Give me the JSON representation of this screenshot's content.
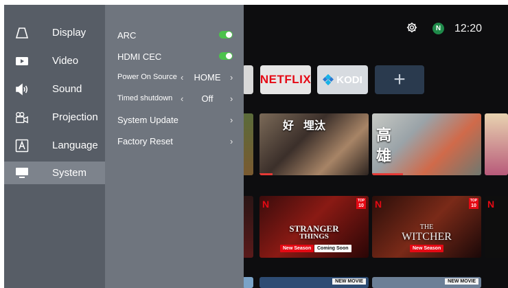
{
  "status_bar": {
    "settings_icon": "gear-icon",
    "profile_initial": "N",
    "time": "12:20"
  },
  "apps": [
    {
      "name": "NETFLIX",
      "icon": "netflix-logo"
    },
    {
      "name": "KODI",
      "icon": "kodi-logo"
    },
    {
      "name": "+",
      "icon": "add-icon"
    }
  ],
  "rows": {
    "row1": [
      {
        "title_a": "好",
        "title_b": "埋汰"
      },
      {
        "title_a": "高",
        "title_b": "雄"
      }
    ],
    "row2": [
      {
        "brand": "N",
        "badge_top": "TOP",
        "badge_num": "10",
        "logo_line1": "STRANGER",
        "logo_line2": "THINGS",
        "tag1": "New Season",
        "tag2": "Coming Soon"
      },
      {
        "brand": "N",
        "badge_top": "TOP",
        "badge_num": "10",
        "logo_line1": "THE",
        "logo_line2": "WITCHER",
        "tag1": "New Season"
      }
    ],
    "row2_partial_brand": "N",
    "row3_badge": "NEW MOVIE"
  },
  "settings": {
    "categories": [
      {
        "label": "Display",
        "icon": "display-icon"
      },
      {
        "label": "Video",
        "icon": "video-icon"
      },
      {
        "label": "Sound",
        "icon": "sound-icon"
      },
      {
        "label": "Projection",
        "icon": "projection-icon"
      },
      {
        "label": "Language",
        "icon": "language-icon"
      },
      {
        "label": "System",
        "icon": "system-icon",
        "selected": true
      }
    ],
    "options": {
      "arc": {
        "label": "ARC",
        "enabled": true
      },
      "hdmi_cec": {
        "label": "HDMI CEC",
        "enabled": true
      },
      "power_on_source": {
        "label": "Power On Source",
        "value": "HOME"
      },
      "timed_shutdown": {
        "label": "Timed shutdown",
        "value": "Off"
      },
      "system_update": {
        "label": "System Update"
      },
      "factory_reset": {
        "label": "Factory Reset"
      }
    },
    "colors": {
      "toggle_on": "#4cc24c",
      "left_panel": "#575d66",
      "right_panel": "#6f757e",
      "selected_item": "#7d838c"
    }
  }
}
